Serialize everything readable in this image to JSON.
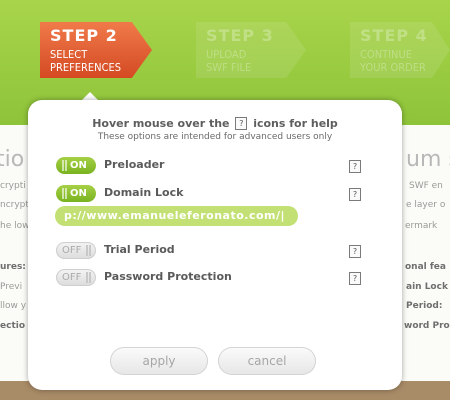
{
  "steps": [
    {
      "title": "STEP 2",
      "line1": "SELECT",
      "line2": "PREFERENCES",
      "state": "active"
    },
    {
      "title": "STEP 3",
      "line1": "UPLOAD",
      "line2": "SWF FILE",
      "state": "inactive"
    },
    {
      "title": "STEP 4",
      "line1": "CONTINUE",
      "line2": "YOUR ORDER",
      "state": "inactive"
    }
  ],
  "dialog": {
    "hint_before": "Hover mouse over the",
    "hint_icon": "?",
    "hint_after": "icons for help",
    "subtitle": "These options are intended for advanced users only",
    "options": [
      {
        "label": "Preloader",
        "toggle": "ON",
        "state": "on"
      },
      {
        "label": "Domain Lock",
        "toggle": "ON",
        "state": "on"
      },
      {
        "label": "Trial Period",
        "toggle": "OFF",
        "state": "off"
      },
      {
        "label": "Password Protection",
        "toggle": "OFF",
        "state": "off"
      }
    ],
    "help_icon": "?",
    "domain_value": "p://www.emanueleferonato.com/|",
    "apply_label": "apply",
    "cancel_label": "cancel"
  },
  "background": {
    "left_fragments": {
      "heading": "tio",
      "lines": [
        "crypti",
        "ncrypt",
        "he low"
      ],
      "bold_lines": [
        "ures:",
        "Previ",
        "llow y",
        "ectio"
      ]
    },
    "right_fragments": {
      "heading": "um s",
      "lines": [
        "SWF en",
        "e layer o",
        "ermark"
      ],
      "bold_lines": [
        "onal fea",
        "ain Lock",
        "Period:",
        "word Pro"
      ]
    }
  },
  "colors": {
    "header_green": "#8ec43a",
    "active_step": "#d44a23",
    "toggle_on": "#79b320",
    "footer_brown": "#a88b67"
  }
}
